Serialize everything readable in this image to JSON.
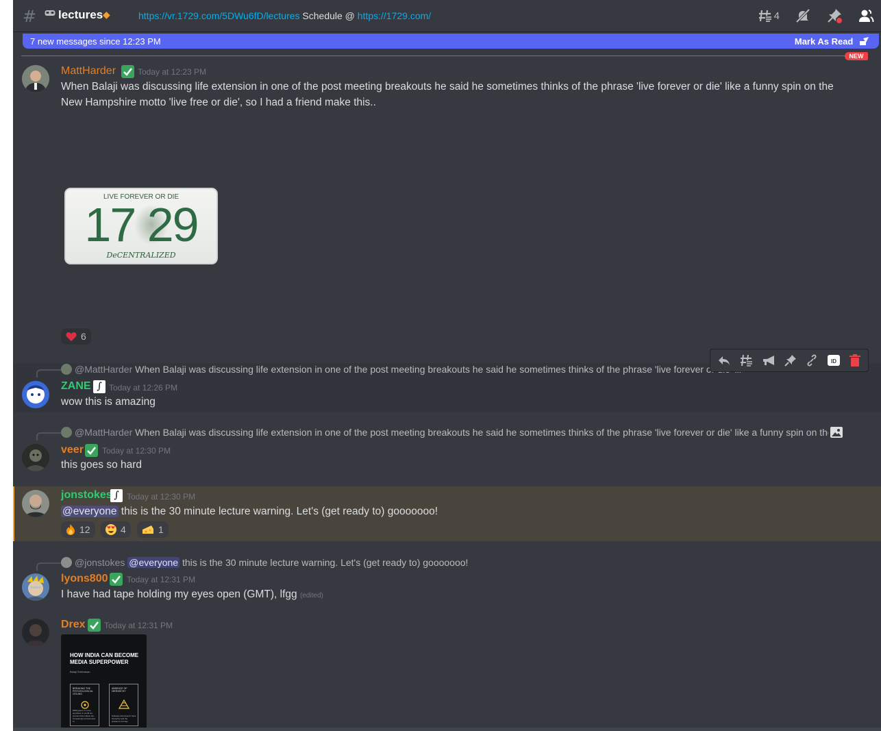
{
  "header": {
    "channel_name": "lectures",
    "topic_link1": "https://vr.1729.com/5DWu6fD/lectures",
    "topic_mid": " Schedule @ ",
    "topic_link2": "https://1729.com/",
    "thread_count": "4"
  },
  "new_messages": {
    "label": "7 new messages since 12:23 PM",
    "mark_read": "Mark As Read",
    "new_pill": "NEW"
  },
  "messages": [
    {
      "author": "MattHarder",
      "author_color": "#e67e22",
      "timestamp": "Today at 12:23 PM",
      "line1": "When Balaji was discussing life extension in one of the post meeting breakouts he said he sometimes thinks of the phrase 'live forever or die' like a funny spin on the",
      "line2": "New Hampshire motto 'live free or die', so I had a friend make this..",
      "plate_top": "LIVE FOREVER OR DIE",
      "plate_number": "17 29",
      "plate_bottom": "DeCENTRALIZED",
      "reaction_count": "6"
    },
    {
      "reply_author": "@MattHarder",
      "reply_text": "When Balaji was discussing life extension in one of the post meeting breakouts he said he sometimes thinks of the phrase 'live forever or die' like a funny spin on the N...",
      "author": "ZANE",
      "author_color": "#2ecc71",
      "badge": "∫",
      "timestamp": "Today at 12:26 PM",
      "text": "wow this is amazing"
    },
    {
      "reply_author": "@MattHarder",
      "reply_text": "When Balaji was discussing life extension in one of the post meeting breakouts he said he sometimes thinks of the phrase 'live forever or die' like a funny spin on the N...",
      "author": "veer",
      "author_color": "#e67e22",
      "timestamp": "Today at 12:30 PM",
      "text": "this goes so hard"
    },
    {
      "author": "jonstokes",
      "author_color": "#2ecc71",
      "badge": "∫",
      "timestamp": "Today at 12:30 PM",
      "mention": "@everyone",
      "text": " this is the 30 minute lecture warning. Let's (get ready to) gooooooo!",
      "reactions": [
        "12",
        "4",
        "1"
      ]
    },
    {
      "reply_author": "@jonstokes",
      "reply_mention": "@everyone",
      "reply_text": " this is the 30 minute lecture warning. Let's (get ready to) gooooooo!",
      "author": "lyons800",
      "author_color": "#e67e22",
      "timestamp": "Today at 12:31 PM",
      "text": "I have had tape holding my eyes open (GMT), lfgg ",
      "edited": "(edited)"
    },
    {
      "author": "Drex",
      "author_color": "#e67e22",
      "timestamp": "Today at 12:31 PM",
      "book_title": "HOW INDIA CAN BECOME MEDIA SUPERPOWER",
      "book_author": "Balaji Srinivasan",
      "card1_title": "BREAKING THE PSYCHOLOGICAL CEILING",
      "card2_title": "ABSENCE OF HIERARCHY",
      "card1_body": "Willingness to move anywhere in world via proxies that Indians are increasingly accustomed to",
      "card2_body": "Software that doesn't have hierarchy and the problems it brings"
    }
  ],
  "colors": {
    "background": "#36393f",
    "accent": "#5865f2",
    "new_red": "#ed4245",
    "link": "#00aff4"
  }
}
